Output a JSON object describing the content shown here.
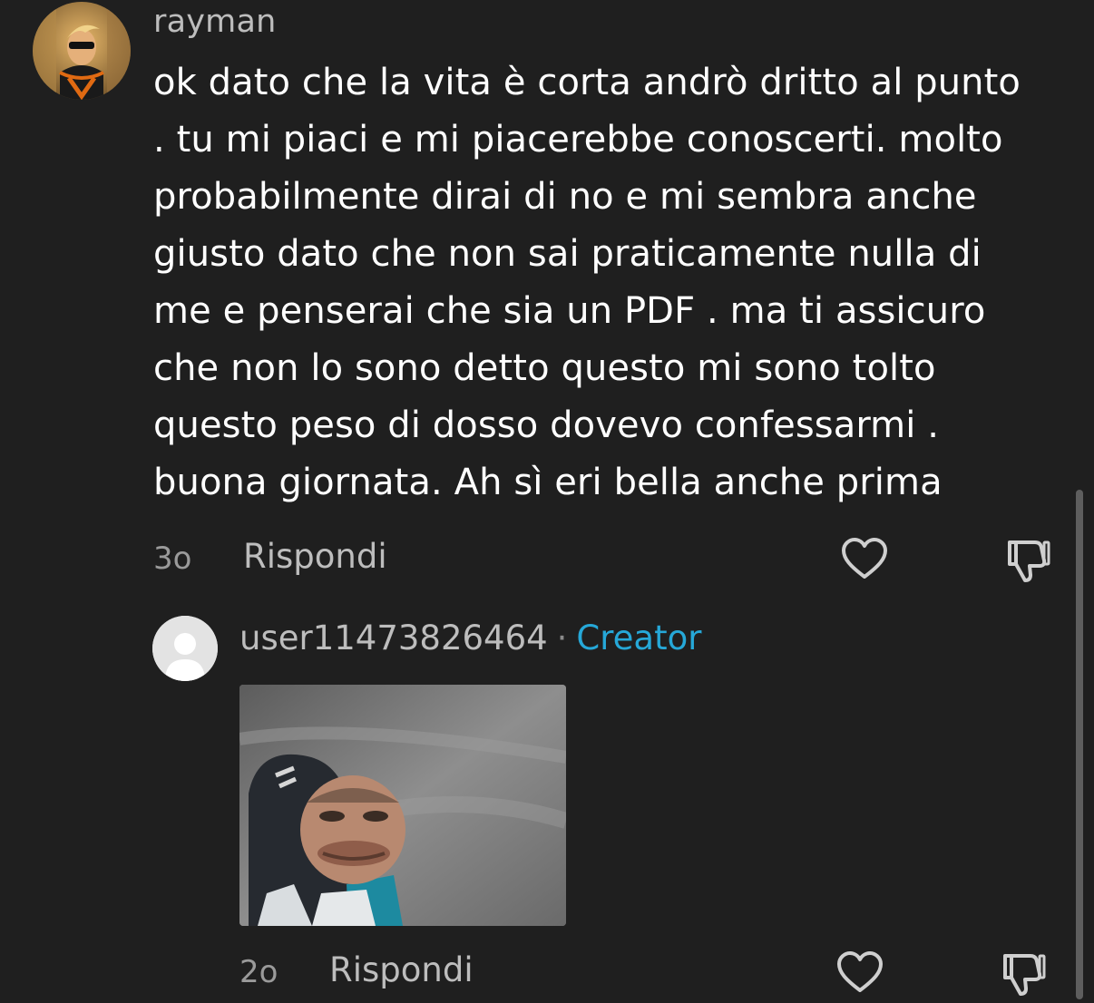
{
  "comment": {
    "username": "rayman",
    "text": "ok dato che la vita è corta andrò dritto al punto\n. tu mi piaci e mi piacerebbe conoscerti. molto\nprobabilmente dirai di no e mi sembra anche\ngiusto dato che non sai praticamente nulla di\nme e penserai che sia un PDF . ma ti assicuro\nche non lo sono detto questo mi sono tolto\nquesto peso di dosso dovevo confessarmi .\nbuona giornata. Ah sì eri bella anche prima",
    "time": "3o",
    "reply_label": "Rispondi",
    "avatar_icon": "cartoon-character-avatar",
    "like_icon": "heart-outline-icon",
    "dislike_icon": "thumbs-down-outline-icon"
  },
  "reply": {
    "username": "user11473826464",
    "separator": "·",
    "badge": "Creator",
    "time": "2o",
    "reply_label": "Rispondi",
    "avatar_icon": "default-user-avatar",
    "gif_icon": "meme-gif",
    "like_icon": "heart-outline-icon",
    "dislike_icon": "thumbs-down-outline-icon"
  },
  "colors": {
    "background": "#1f1f1f",
    "text": "#ffffff",
    "muted": "#bdbdbd",
    "creator": "#26a8d8"
  }
}
